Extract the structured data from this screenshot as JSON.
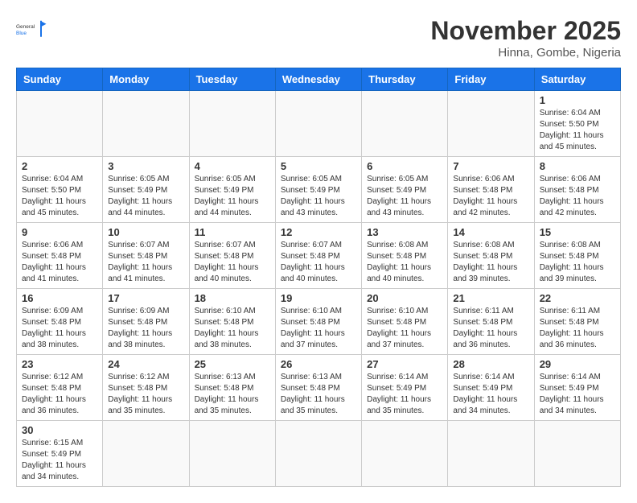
{
  "header": {
    "logo_text_general": "General",
    "logo_text_blue": "Blue",
    "month_title": "November 2025",
    "subtitle": "Hinna, Gombe, Nigeria"
  },
  "weekdays": [
    "Sunday",
    "Monday",
    "Tuesday",
    "Wednesday",
    "Thursday",
    "Friday",
    "Saturday"
  ],
  "days": {
    "d1": {
      "num": "1",
      "sunrise": "6:04 AM",
      "sunset": "5:50 PM",
      "daylight": "11 hours and 45 minutes."
    },
    "d2": {
      "num": "2",
      "sunrise": "6:04 AM",
      "sunset": "5:50 PM",
      "daylight": "11 hours and 45 minutes."
    },
    "d3": {
      "num": "3",
      "sunrise": "6:05 AM",
      "sunset": "5:49 PM",
      "daylight": "11 hours and 44 minutes."
    },
    "d4": {
      "num": "4",
      "sunrise": "6:05 AM",
      "sunset": "5:49 PM",
      "daylight": "11 hours and 44 minutes."
    },
    "d5": {
      "num": "5",
      "sunrise": "6:05 AM",
      "sunset": "5:49 PM",
      "daylight": "11 hours and 43 minutes."
    },
    "d6": {
      "num": "6",
      "sunrise": "6:05 AM",
      "sunset": "5:49 PM",
      "daylight": "11 hours and 43 minutes."
    },
    "d7": {
      "num": "7",
      "sunrise": "6:06 AM",
      "sunset": "5:48 PM",
      "daylight": "11 hours and 42 minutes."
    },
    "d8": {
      "num": "8",
      "sunrise": "6:06 AM",
      "sunset": "5:48 PM",
      "daylight": "11 hours and 42 minutes."
    },
    "d9": {
      "num": "9",
      "sunrise": "6:06 AM",
      "sunset": "5:48 PM",
      "daylight": "11 hours and 41 minutes."
    },
    "d10": {
      "num": "10",
      "sunrise": "6:07 AM",
      "sunset": "5:48 PM",
      "daylight": "11 hours and 41 minutes."
    },
    "d11": {
      "num": "11",
      "sunrise": "6:07 AM",
      "sunset": "5:48 PM",
      "daylight": "11 hours and 40 minutes."
    },
    "d12": {
      "num": "12",
      "sunrise": "6:07 AM",
      "sunset": "5:48 PM",
      "daylight": "11 hours and 40 minutes."
    },
    "d13": {
      "num": "13",
      "sunrise": "6:08 AM",
      "sunset": "5:48 PM",
      "daylight": "11 hours and 40 minutes."
    },
    "d14": {
      "num": "14",
      "sunrise": "6:08 AM",
      "sunset": "5:48 PM",
      "daylight": "11 hours and 39 minutes."
    },
    "d15": {
      "num": "15",
      "sunrise": "6:08 AM",
      "sunset": "5:48 PM",
      "daylight": "11 hours and 39 minutes."
    },
    "d16": {
      "num": "16",
      "sunrise": "6:09 AM",
      "sunset": "5:48 PM",
      "daylight": "11 hours and 38 minutes."
    },
    "d17": {
      "num": "17",
      "sunrise": "6:09 AM",
      "sunset": "5:48 PM",
      "daylight": "11 hours and 38 minutes."
    },
    "d18": {
      "num": "18",
      "sunrise": "6:10 AM",
      "sunset": "5:48 PM",
      "daylight": "11 hours and 38 minutes."
    },
    "d19": {
      "num": "19",
      "sunrise": "6:10 AM",
      "sunset": "5:48 PM",
      "daylight": "11 hours and 37 minutes."
    },
    "d20": {
      "num": "20",
      "sunrise": "6:10 AM",
      "sunset": "5:48 PM",
      "daylight": "11 hours and 37 minutes."
    },
    "d21": {
      "num": "21",
      "sunrise": "6:11 AM",
      "sunset": "5:48 PM",
      "daylight": "11 hours and 36 minutes."
    },
    "d22": {
      "num": "22",
      "sunrise": "6:11 AM",
      "sunset": "5:48 PM",
      "daylight": "11 hours and 36 minutes."
    },
    "d23": {
      "num": "23",
      "sunrise": "6:12 AM",
      "sunset": "5:48 PM",
      "daylight": "11 hours and 36 minutes."
    },
    "d24": {
      "num": "24",
      "sunrise": "6:12 AM",
      "sunset": "5:48 PM",
      "daylight": "11 hours and 35 minutes."
    },
    "d25": {
      "num": "25",
      "sunrise": "6:13 AM",
      "sunset": "5:48 PM",
      "daylight": "11 hours and 35 minutes."
    },
    "d26": {
      "num": "26",
      "sunrise": "6:13 AM",
      "sunset": "5:48 PM",
      "daylight": "11 hours and 35 minutes."
    },
    "d27": {
      "num": "27",
      "sunrise": "6:14 AM",
      "sunset": "5:49 PM",
      "daylight": "11 hours and 35 minutes."
    },
    "d28": {
      "num": "28",
      "sunrise": "6:14 AM",
      "sunset": "5:49 PM",
      "daylight": "11 hours and 34 minutes."
    },
    "d29": {
      "num": "29",
      "sunrise": "6:14 AM",
      "sunset": "5:49 PM",
      "daylight": "11 hours and 34 minutes."
    },
    "d30": {
      "num": "30",
      "sunrise": "6:15 AM",
      "sunset": "5:49 PM",
      "daylight": "11 hours and 34 minutes."
    }
  },
  "labels": {
    "sunrise": "Sunrise:",
    "sunset": "Sunset:",
    "daylight": "Daylight:"
  }
}
